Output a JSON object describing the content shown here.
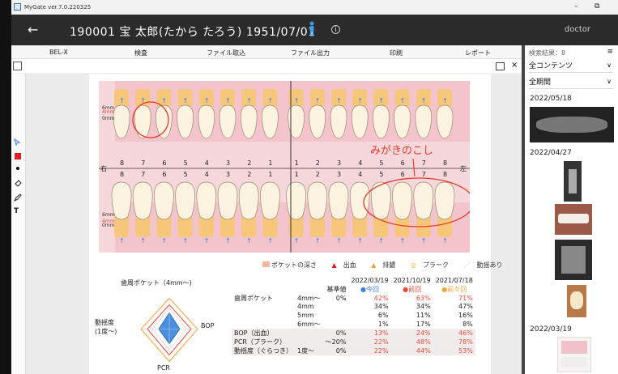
{
  "titlebar": {
    "title": "MyGate ver.7.0.220325",
    "min": "–",
    "restore": "⧉"
  },
  "header": {
    "back": "←",
    "patient": "190001 宝 太郎(たから たろう) 1951/07/01",
    "info": "i",
    "user": "doctor"
  },
  "menu": [
    "BEL-X",
    "検査",
    "ファイル取込",
    "ファイル出力",
    "印刷",
    "レポート"
  ],
  "toolbar": {
    "close": "×"
  },
  "lefttools": {
    "pen": "T"
  },
  "chart": {
    "labels_mm": [
      "6mm",
      "4mm",
      "0mm"
    ],
    "side_right": "右",
    "side_left": "左",
    "upper_nums": [
      "8",
      "7",
      "6",
      "5",
      "4",
      "3",
      "2",
      "1",
      "1",
      "2",
      "3",
      "4",
      "5",
      "6",
      "7",
      "8"
    ],
    "lower_nums": [
      "8",
      "7",
      "6",
      "5",
      "4",
      "3",
      "2",
      "1",
      "1",
      "2",
      "3",
      "4",
      "5",
      "6",
      "7",
      "8"
    ],
    "annotation": "みがきのこし",
    "legend": [
      "ポケットの深さ",
      "出血",
      "排膿",
      "プラーク",
      "動揺あり"
    ]
  },
  "radar": {
    "title": "歯周ポケット（4mm〜)",
    "left": "動揺度\n(1度〜)",
    "right": "BOP",
    "bottom": "PCR"
  },
  "stats": {
    "dates": [
      "2022/03/19",
      "2021/10/19",
      "2021/07/18"
    ],
    "std_header": "基準値",
    "tags": [
      "●今回",
      "●前回",
      "●前々回"
    ],
    "rows": [
      [
        "歯周ポケット",
        "4mm〜",
        "0%",
        "42%",
        "63%",
        "71%"
      ],
      [
        "",
        "4mm",
        "",
        "34%",
        "34%",
        "47%"
      ],
      [
        "",
        "5mm",
        "",
        "6%",
        "11%",
        "16%"
      ],
      [
        "",
        "6mm〜",
        "",
        "1%",
        "17%",
        "8%"
      ],
      [
        "BOP（出血）",
        "",
        "0%",
        "13%",
        "24%",
        "46%"
      ],
      [
        "PCR（プラーク）",
        "",
        "〜20%",
        "22%",
        "48%",
        "78%"
      ],
      [
        "動揺度（ぐらつき）",
        "1度〜",
        "0%",
        "22%",
        "44%",
        "53%"
      ]
    ]
  },
  "sidebar": {
    "count": "検索結果：8",
    "filter": "全コンテンツ",
    "period": "全期間",
    "dates": [
      "2022/05/18",
      "2022/04/27",
      "2022/03/19"
    ]
  },
  "colors": {
    "accent_blue": "#3a7ee0",
    "red": "#e84a3a",
    "orange": "#f1a43a",
    "pink": "#f4c9cf"
  }
}
